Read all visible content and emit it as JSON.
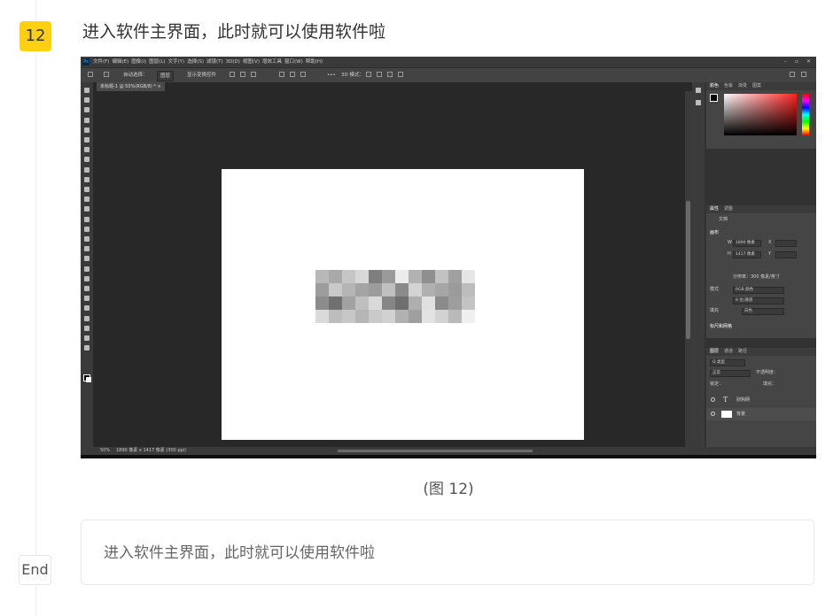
{
  "step": {
    "number": "12",
    "title": "进入软件主界面，此时就可以使用软件啦",
    "badge_color": "#ffd012"
  },
  "screenshot": {
    "app": "Photoshop",
    "menu_items": [
      "文件(F)",
      "编辑(E)",
      "图像(I)",
      "图层(L)",
      "文字(Y)",
      "选择(S)",
      "滤镜(T)",
      "3D(D)",
      "视图(V)",
      "增效工具",
      "窗口(W)",
      "帮助(H)"
    ],
    "window_controls": [
      "–",
      "▫",
      "✕"
    ],
    "options_bar": {
      "auto_select_label": "自动选择：",
      "auto_select_value": "图层",
      "show_transform_label": "显示变换控件",
      "three_d_mode_label": "3D 模式："
    },
    "doc_tab": "未标题-1 @ 50%(RGB/8) * ×",
    "status": {
      "zoom": "50%",
      "info": "1890 像素 x 1417 像素 (300 ppi)"
    },
    "color_panel_tabs": [
      "颜色",
      "色板",
      "渐变",
      "图案"
    ],
    "properties_panel": {
      "tabs": [
        "属性",
        "调整"
      ],
      "doc_label": "文档",
      "canvas_label": "画布",
      "width_label": "W",
      "width_value": "1890 像素",
      "height_label": "H",
      "height_value": "1417 像素",
      "x_label": "X",
      "y_label": "Y",
      "resolution": "分辨率：300 像素/英寸",
      "mode_label": "模式",
      "mode_value": "RGB 颜色",
      "bit_value": "8 位/通道",
      "fill_label": "填充",
      "fill_value": "白色",
      "rulers_label": "标尺和网格"
    },
    "layers_panel": {
      "tabs": [
        "图层",
        "通道",
        "路径"
      ],
      "filter_value": "Q 类型",
      "blend_mode": "正常",
      "opacity_label": "不透明度：",
      "lock_label": "锁定：",
      "fill_label": "填充：",
      "layers": [
        {
          "kind": "text",
          "name": "别钩网"
        },
        {
          "kind": "image",
          "name": "背景"
        }
      ]
    },
    "ime": {
      "logo": "S",
      "text": "中"
    }
  },
  "caption": "(图 12)",
  "note": "进入软件主界面，此时就可以使用软件啦",
  "end_label": "End"
}
